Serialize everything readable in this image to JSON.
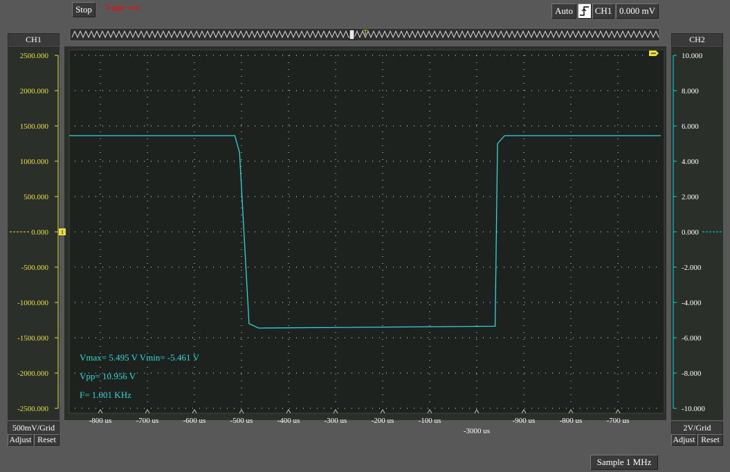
{
  "toolbar": {
    "stop_label": "Stop",
    "status_text": "Trigger wait",
    "auto_label": "Auto",
    "trigger_edge_icon": "rising-edge-icon",
    "trigger_channel": "CH1",
    "trigger_level": "0.000 mV"
  },
  "ch1": {
    "title": "CH1",
    "scale": "500mV/Grid",
    "adjust_label": "Adjust",
    "reset_label": "Reset",
    "ticks": [
      "2500.000",
      "2000.000",
      "1500.000",
      "1000.000",
      "500.000",
      "0.000",
      "-500.000",
      "-1000.000",
      "-1500.000",
      "-2000.000",
      "-2500.000"
    ],
    "color": "#e8e040"
  },
  "ch2": {
    "title": "CH2",
    "scale": "2V/Grid",
    "adjust_label": "Adjust",
    "reset_label": "Reset",
    "ticks": [
      "10.000",
      "8.000",
      "6.000",
      "4.000",
      "2.000",
      "0.000",
      "-2.000",
      "-4.000",
      "-6.000",
      "-8.000",
      "-10.000"
    ],
    "color": "#00e0e0"
  },
  "xaxis": {
    "ticks": [
      "-800 us",
      "-700 us",
      "-600 us",
      "-500 us",
      "-400 us",
      "-300 us",
      "-200 us",
      "-100 us",
      "",
      "-900 us",
      "-800 us",
      "-700 us"
    ],
    "offset_label": "-3000 us"
  },
  "measurements": {
    "vmax_vmin": "Vmax= 5.495 V  Vmin= -5.461 V",
    "vpp": "Vpp= 10.956 V",
    "freq": "F= 1.001 KHz"
  },
  "sample_label": "Sample 1 MHz",
  "trace_color": "#30d8d8",
  "grid_color": "#c8c8c8",
  "chart_data": {
    "type": "line",
    "series": [
      {
        "x": [
          -1000,
          -650,
          -640,
          -620,
          -600,
          -100,
          -95,
          -80,
          250
        ],
        "y": [
          5.45,
          5.45,
          4.5,
          -5.2,
          -5.45,
          -5.35,
          5.0,
          5.45,
          5.45
        ]
      }
    ],
    "ylim": [
      -10,
      10
    ],
    "xlim": [
      -1000,
      250
    ]
  }
}
